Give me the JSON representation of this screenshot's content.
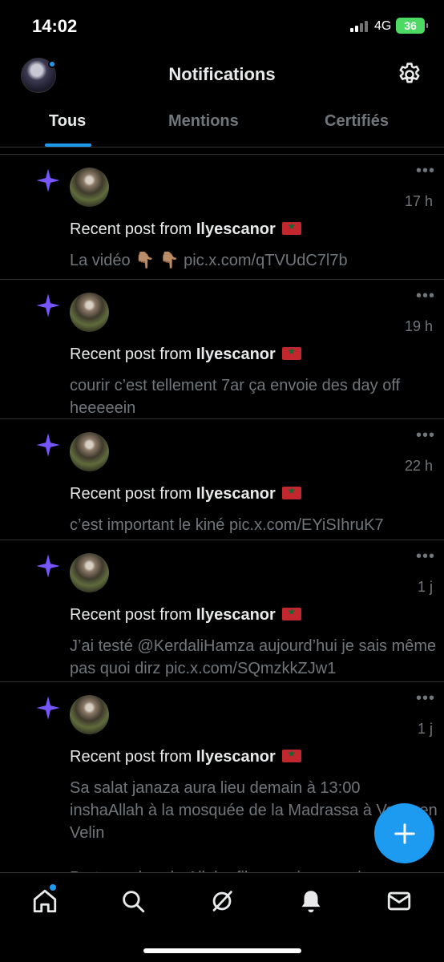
{
  "status_bar": {
    "time": "14:02",
    "network": "4G",
    "battery": "36"
  },
  "header": {
    "title": "Notifications"
  },
  "tabs": [
    {
      "label": "Tous",
      "active": true
    },
    {
      "label": "Mentions",
      "active": false
    },
    {
      "label": "Certifiés",
      "active": false
    }
  ],
  "notifications": [
    {
      "prefix": "Recent post from ",
      "author": "Ilyescanor",
      "time": "17 h",
      "more": "•••",
      "text": "La vidéo 👇🏽 👇🏽 pic.x.com/qTVUdC7l7b"
    },
    {
      "prefix": "Recent post from ",
      "author": "Ilyescanor",
      "time": "19 h",
      "more": "•••",
      "text": "courir c’est tellement 7ar ça envoie des day off heeeeein"
    },
    {
      "prefix": "Recent post from ",
      "author": "Ilyescanor",
      "time": "22 h",
      "more": "•••",
      "text": "c’est important le kiné pic.x.com/EYiSIhruK7"
    },
    {
      "prefix": "Recent post from ",
      "author": "Ilyescanor",
      "time": "1 j",
      "more": "•••",
      "text": "J’ai testé @KerdaliHamza aujourd’hui je sais même pas quoi dirz pic.x.com/SQmzkkZJw1"
    },
    {
      "prefix": "Recent post from ",
      "author": "Ilyescanor",
      "time": "1 j",
      "more": "•••",
      "text": "Sa salat janaza aura lieu demain à 13:00 inshaAllah à la mosquée de la Madrassa à Vaulx en Velin\n\nPartagez barakaAllahu fikoum pic.x.com/"
    }
  ],
  "icons": {
    "settings": "gear-icon",
    "star": "sparkle-icon",
    "fab": "plus-icon",
    "nav": [
      "home-icon",
      "search-icon",
      "grok-icon",
      "bell-icon",
      "mail-icon"
    ]
  },
  "colors": {
    "accent": "#1d9bf0",
    "star": "#7856ff",
    "background": "#000000",
    "muted": "#71767b"
  }
}
